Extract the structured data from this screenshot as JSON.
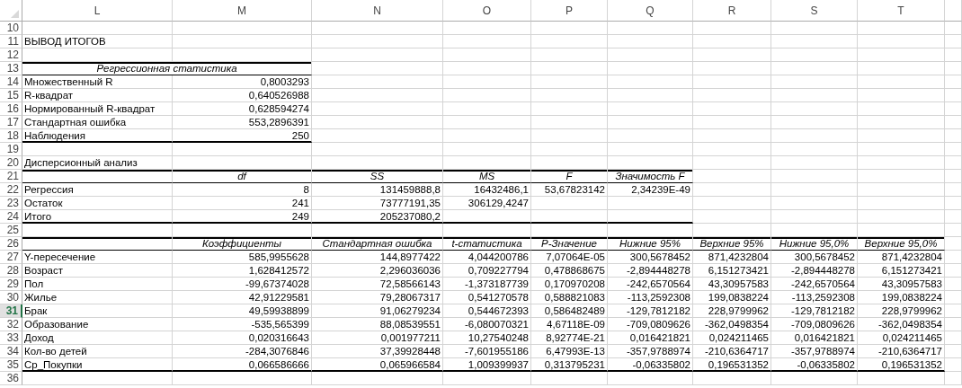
{
  "columns": [
    {
      "label": "L",
      "selected": false
    },
    {
      "label": "M",
      "selected": false
    },
    {
      "label": "N",
      "selected": false
    },
    {
      "label": "O",
      "selected": false
    },
    {
      "label": "P",
      "selected": false
    },
    {
      "label": "Q",
      "selected": false
    },
    {
      "label": "R",
      "selected": false
    },
    {
      "label": "S",
      "selected": false
    },
    {
      "label": "T",
      "selected": false
    }
  ],
  "rows": [
    {
      "number": "10",
      "selected": false,
      "kind": "blank"
    },
    {
      "number": "11",
      "selected": false,
      "kind": "text",
      "cells": [
        "ВЫВОД ИТОГОВ"
      ]
    },
    {
      "number": "12",
      "selected": false,
      "kind": "blank"
    },
    {
      "number": "13",
      "selected": false,
      "kind": "head",
      "cells": [
        "Регрессионная статистика"
      ]
    },
    {
      "number": "14",
      "selected": false,
      "kind": "data",
      "cells": [
        "Множественный R",
        "0,8003293"
      ]
    },
    {
      "number": "15",
      "selected": false,
      "kind": "data",
      "cells": [
        "R-квадрат",
        "0,640526988"
      ]
    },
    {
      "number": "16",
      "selected": false,
      "kind": "data",
      "cells": [
        "Нормированный R-квадрат",
        "0,628594274"
      ]
    },
    {
      "number": "17",
      "selected": false,
      "kind": "data",
      "cells": [
        "Стандартная ошибка",
        "553,2896391"
      ]
    },
    {
      "number": "18",
      "selected": false,
      "kind": "last",
      "cells": [
        "Наблюдения",
        "250"
      ]
    },
    {
      "number": "19",
      "selected": false,
      "kind": "blank"
    },
    {
      "number": "20",
      "selected": false,
      "kind": "text",
      "cells": [
        "Дисперсионный анализ"
      ]
    },
    {
      "number": "21",
      "selected": false,
      "kind": "head",
      "cells": [
        null,
        "df",
        "SS",
        "MS",
        "F",
        "Значимость F"
      ]
    },
    {
      "number": "22",
      "selected": false,
      "kind": "data",
      "cells": [
        "Регрессия",
        "8",
        "131459888,8",
        "16432486,1",
        "53,67823142",
        "2,34239E-49"
      ]
    },
    {
      "number": "23",
      "selected": false,
      "kind": "data",
      "cells": [
        "Остаток",
        "241",
        "73777191,35",
        "306129,4247"
      ]
    },
    {
      "number": "24",
      "selected": false,
      "kind": "last",
      "cells": [
        "Итого",
        "249",
        "205237080,2"
      ]
    },
    {
      "number": "25",
      "selected": false,
      "kind": "blank"
    },
    {
      "number": "26",
      "selected": false,
      "kind": "head",
      "cells": [
        null,
        "Коэффициенты",
        "Стандартная ошибка",
        "t-статистика",
        "P-Значение",
        "Нижние 95%",
        "Верхние 95%",
        "Нижние 95,0%",
        "Верхние 95,0%"
      ]
    },
    {
      "number": "27",
      "selected": false,
      "kind": "data",
      "cells": [
        "Y-пересечение",
        "585,9955628",
        "144,8977422",
        "4,044200786",
        "7,07064E-05",
        "300,5678452",
        "871,4232804",
        "300,5678452",
        "871,4232804"
      ]
    },
    {
      "number": "28",
      "selected": false,
      "kind": "data",
      "cells": [
        "Возраст",
        "1,628412572",
        "2,296036036",
        "0,709227794",
        "0,478868675",
        "-2,894448278",
        "6,151273421",
        "-2,894448278",
        "6,151273421"
      ]
    },
    {
      "number": "29",
      "selected": false,
      "kind": "data",
      "cells": [
        "Пол",
        "-99,67374028",
        "72,58566143",
        "-1,373187739",
        "0,170970208",
        "-242,6570564",
        "43,30957583",
        "-242,6570564",
        "43,30957583"
      ]
    },
    {
      "number": "30",
      "selected": false,
      "kind": "data",
      "cells": [
        "Жилье",
        "42,91229581",
        "79,28067317",
        "0,541270578",
        "0,588821083",
        "-113,2592308",
        "199,0838224",
        "-113,2592308",
        "199,0838224"
      ]
    },
    {
      "number": "31",
      "selected": true,
      "kind": "data",
      "cells": [
        "Брак",
        "49,59938899",
        "91,06279234",
        "0,544672393",
        "0,586482489",
        "-129,7812182",
        "228,9799962",
        "-129,7812182",
        "228,9799962"
      ]
    },
    {
      "number": "32",
      "selected": false,
      "kind": "data",
      "cells": [
        "Образование",
        "-535,565399",
        "88,08539551",
        "-6,080070321",
        "4,67118E-09",
        "-709,0809626",
        "-362,0498354",
        "-709,0809626",
        "-362,0498354"
      ]
    },
    {
      "number": "33",
      "selected": false,
      "kind": "data",
      "cells": [
        "Доход",
        "0,020316643",
        "0,001977211",
        "10,27540248",
        "8,92774E-21",
        "0,016421821",
        "0,024211465",
        "0,016421821",
        "0,024211465"
      ]
    },
    {
      "number": "34",
      "selected": false,
      "kind": "data",
      "cells": [
        "Кол-во детей",
        "-284,3076846",
        "37,39928448",
        "-7,601955186",
        "6,47993E-13",
        "-357,9788974",
        "-210,6364717",
        "-357,9788974",
        "-210,6364717"
      ]
    },
    {
      "number": "35",
      "selected": false,
      "kind": "last",
      "cells": [
        "Ср_Покупки",
        "0,066586666",
        "0,065966584",
        "1,009399937",
        "0,313795231",
        "-0,06335802",
        "0,196531352",
        "-0,06335802",
        "0,196531352"
      ]
    },
    {
      "number": "36",
      "selected": false,
      "kind": "blank"
    }
  ]
}
